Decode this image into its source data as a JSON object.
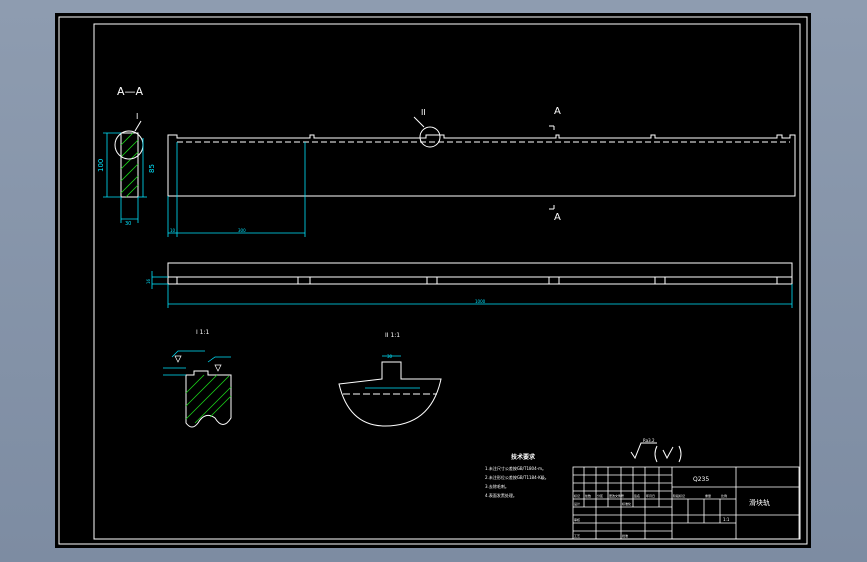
{
  "colors": {
    "background": "#7f8ea4",
    "sheet": "#000000",
    "linework": "#ffffff",
    "dimension": "#00e5ff",
    "hatch": "#19d219"
  },
  "sections": {
    "section_label": "A—A",
    "detail_label_1": "I",
    "detail_label_2": "II",
    "cut_mark_top": "A",
    "cut_mark_bottom": "A"
  },
  "dimensions": {
    "section_height": "100",
    "section_inner": "85",
    "section_width": "30",
    "offset_small": "10",
    "slot_span": "300",
    "overall_length": "1000",
    "thickness": "16",
    "detail_small": "30"
  },
  "detail_views": {
    "view1_scale": "I\n1:1",
    "view2_scale": "II\n1:1"
  },
  "tech_requirements": {
    "title": "技术要求",
    "items": [
      "1.未注尺寸公差按GB/T1804-m。",
      "2.未注形位公差按GB/T1184-K级。",
      "3.去除毛刺。",
      "4.表面发黑处理。"
    ]
  },
  "title_block": {
    "material": "Q235",
    "part_name": "滑块轨",
    "scale": "1:1",
    "labels": [
      "标记",
      "处数",
      "分区",
      "更改文件号",
      "签名",
      "年月日",
      "设计",
      "标准化",
      "审核",
      "工艺",
      "批准",
      "阶段标记",
      "重量",
      "比例"
    ]
  },
  "roughness": {
    "value": "Ra3.2"
  }
}
